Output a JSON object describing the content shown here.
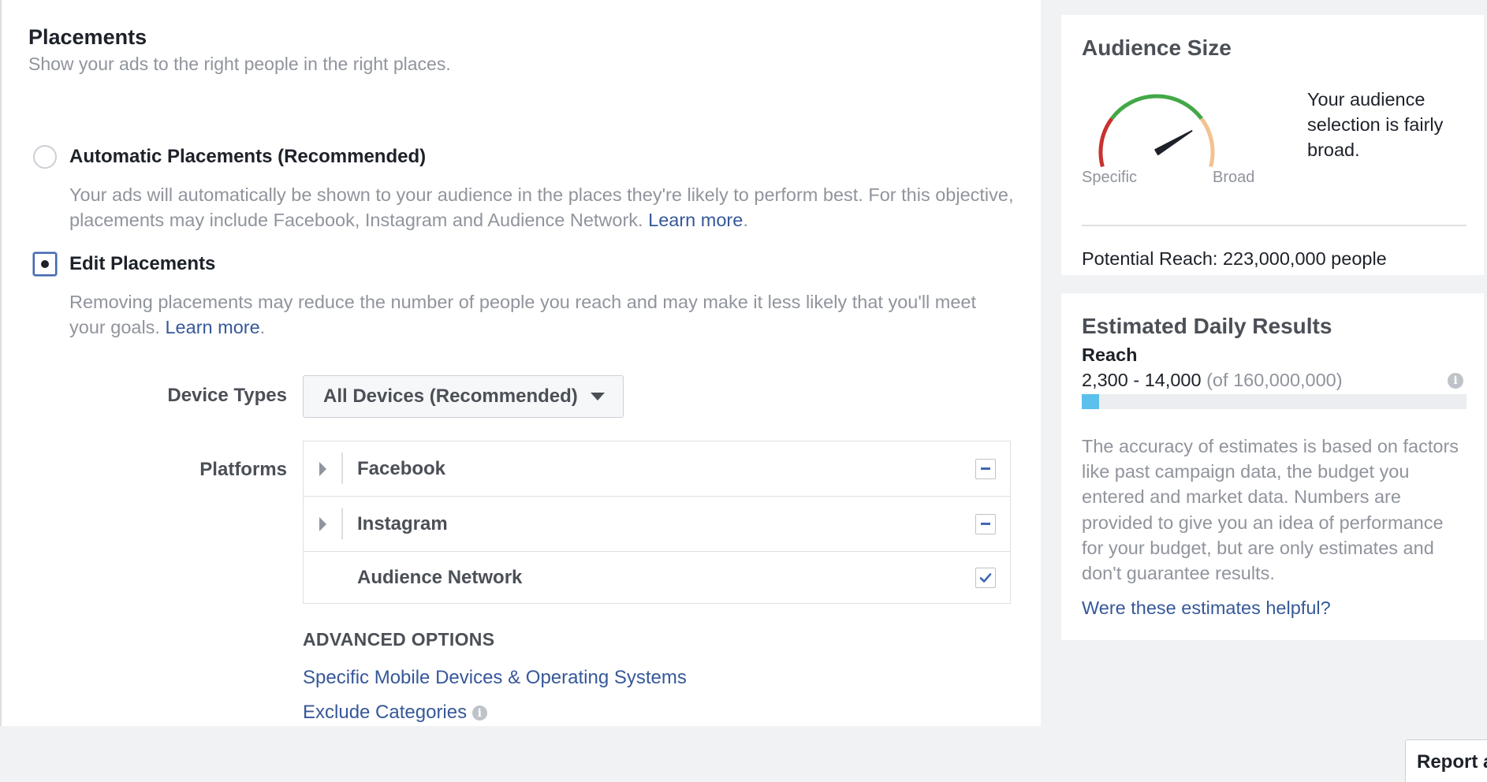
{
  "placements": {
    "title": "Placements",
    "subtitle": "Show your ads to the right people in the right places.",
    "automatic": {
      "label": "Automatic Placements (Recommended)",
      "description": "Your ads will automatically be shown to your audience in the places they're likely to perform best. For this objective, placements may include Facebook, Instagram and Audience Network.",
      "learn_more": "Learn more",
      "selected": false
    },
    "edit": {
      "label": "Edit Placements",
      "description": "Removing placements may reduce the number of people you reach and may make it less likely that you'll meet your goals.",
      "learn_more": "Learn more",
      "selected": true
    },
    "device_types": {
      "label": "Device Types",
      "value": "All Devices (Recommended)"
    },
    "platforms": {
      "label": "Platforms",
      "items": [
        {
          "name": "Facebook",
          "state": "partial",
          "expandable": true
        },
        {
          "name": "Instagram",
          "state": "partial",
          "expandable": true
        },
        {
          "name": "Audience Network",
          "state": "checked",
          "expandable": false
        }
      ]
    },
    "advanced": {
      "title": "ADVANCED OPTIONS",
      "links": [
        "Specific Mobile Devices & Operating Systems",
        "Exclude Categories"
      ]
    }
  },
  "audience_size": {
    "title": "Audience Size",
    "gauge_min_label": "Specific",
    "gauge_max_label": "Broad",
    "gauge_level": 0.78,
    "description": "Your audience selection is fairly broad.",
    "potential_reach": "Potential Reach: 223,000,000 people",
    "colors": {
      "specific": "#c8322e",
      "middle": "#42a846",
      "broad": "#f3c28f",
      "needle": "#1d2129"
    }
  },
  "daily_results": {
    "title": "Estimated Daily Results",
    "reach_label": "Reach",
    "reach_range": "2,300 - 14,000",
    "reach_total": "(of 160,000,000)",
    "reach_fill_fraction": 0.046,
    "bar_color": "#5bc0eb",
    "note": "The accuracy of estimates is based on factors like past campaign data, the budget you entered and market data. Numbers are provided to give you an idea of performance for your budget, but are only estimates and don't guarantee results.",
    "feedback_link": "Were these estimates helpful?"
  },
  "footer": {
    "report_button": "Report a"
  }
}
